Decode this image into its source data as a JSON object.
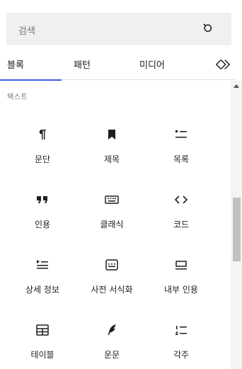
{
  "search": {
    "placeholder": "검색"
  },
  "tabs": [
    {
      "label": "블록"
    },
    {
      "label": "패턴"
    },
    {
      "label": "미디어"
    }
  ],
  "category": {
    "title": "텍스트"
  },
  "blocks": [
    {
      "label": "문단",
      "icon": "paragraph-icon"
    },
    {
      "label": "제목",
      "icon": "bookmark-icon"
    },
    {
      "label": "목록",
      "icon": "list-icon"
    },
    {
      "label": "인용",
      "icon": "quote-icon"
    },
    {
      "label": "클래식",
      "icon": "keyboard-icon"
    },
    {
      "label": "코드",
      "icon": "code-icon"
    },
    {
      "label": "상세 정보",
      "icon": "details-icon"
    },
    {
      "label": "사전 서식화",
      "icon": "preformatted-icon"
    },
    {
      "label": "내부 인용",
      "icon": "pullquote-icon"
    },
    {
      "label": "테이블",
      "icon": "table-icon"
    },
    {
      "label": "운문",
      "icon": "verse-icon"
    },
    {
      "label": "각주",
      "icon": "footnotes-icon"
    }
  ],
  "colors": {
    "accent": "#3858e9",
    "text": "#1e1e1e",
    "muted": "#757575"
  }
}
